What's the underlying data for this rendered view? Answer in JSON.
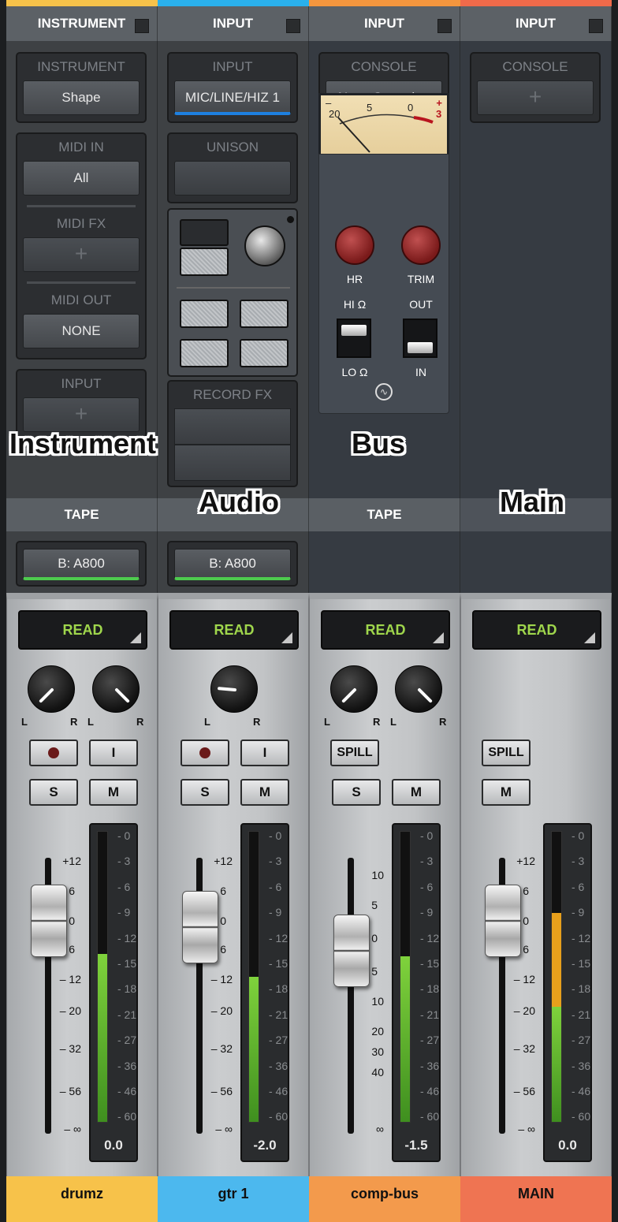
{
  "channels": [
    {
      "color": "#f7c24a",
      "header": "INSTRUMENT",
      "slot1_label": "INSTRUMENT",
      "slot1_value": "Shape",
      "midi_in_label": "MIDI IN",
      "midi_in_value": "All",
      "midi_fx_label": "MIDI FX",
      "midi_out_label": "MIDI OUT",
      "midi_out_value": "NONE",
      "input_label": "INPUT",
      "tape_header": "TAPE",
      "tape_value": "B: A800",
      "automation": "READ",
      "rec_button": "",
      "input_button": "I",
      "solo": "S",
      "mute": "M",
      "fader_value": 0.0,
      "meter_readout": "0.0",
      "meter_level": 0.58,
      "name": "drumz",
      "namecolor": "#f7c24a"
    },
    {
      "color": "#2ab0ec",
      "header": "INPUT",
      "slot1_label": "INPUT",
      "slot1_value": "MIC/LINE/HIZ 1",
      "unison_label": "UNISON",
      "recordfx_label": "RECORD FX",
      "tape_value": "B: A800",
      "automation": "READ",
      "input_button": "I",
      "solo": "S",
      "mute": "M",
      "fader_value": -2.0,
      "meter_readout": "-2.0",
      "meter_level": 0.5,
      "name": "gtr 1",
      "namecolor": "#4cb8ee"
    },
    {
      "color": "#f4963e",
      "header": "INPUT",
      "slot1_label": "CONSOLE",
      "slot1_value": "Neve Summing",
      "hr_label": "HR",
      "trim_label": "TRIM",
      "hi_label": "HI Ω",
      "out_label": "OUT",
      "lo_label": "LO Ω",
      "in_label": "IN",
      "tape_header": "TAPE",
      "automation": "READ",
      "spill": "SPILL",
      "solo": "S",
      "mute": "M",
      "fader_value": -1.5,
      "meter_readout": "-1.5",
      "meter_level": 0.57,
      "name": "comp-bus",
      "namecolor": "#f39a4c"
    },
    {
      "color": "#f06a4a",
      "header": "INPUT",
      "slot1_label": "CONSOLE",
      "automation": "READ",
      "spill": "SPILL",
      "mute": "M",
      "fader_value": 0.0,
      "meter_readout": "0.0",
      "meter_level": 0.72,
      "name": "MAIN",
      "namecolor": "#ef7452"
    }
  ],
  "vu_scale": [
    "20",
    "5",
    "0",
    "3"
  ],
  "vu_signs": [
    "–",
    "+"
  ],
  "fader_scale_a": [
    "+12",
    "6",
    "0",
    "6",
    "– 12",
    "– 20",
    "– 32",
    "– 56",
    "– ∞"
  ],
  "fader_scale_b": [
    "10",
    "5",
    "0",
    "5",
    "10",
    "20",
    "30",
    "40",
    "∞"
  ],
  "meter_scale": [
    "0",
    "3",
    "6",
    "9",
    "12",
    "15",
    "18",
    "21",
    "27",
    "36",
    "46",
    "60"
  ],
  "pan_labels": {
    "l": "L",
    "r": "R"
  },
  "overlays": {
    "instrument": "Instrument",
    "audio": "Audio",
    "bus": "Bus",
    "main": "Main"
  }
}
